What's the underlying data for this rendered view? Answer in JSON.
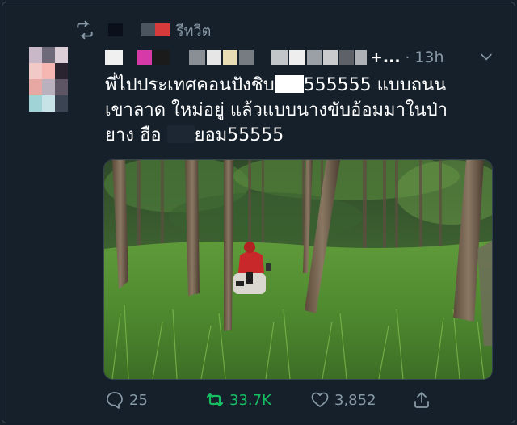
{
  "header": {
    "retweet_label": "รีทวีต"
  },
  "author": {
    "more_marker": "+...",
    "time": "13h"
  },
  "tweet": {
    "line1_a": "พี่ไปประเทศคอนปังชิบ",
    "line1_b": "555555 แบบถนน",
    "line2": "เขาลาด ใหม่อยู่ แล้วแบบนางขับอ้อมมาในป่า",
    "line3_a": "ยาง ฮือ ",
    "line3_b": "ยอม55555"
  },
  "photo": {
    "alt_icon": "rubber-plantation-scooter-photo"
  },
  "actions": {
    "replies": "25",
    "retweets": "33.7K",
    "likes": "3,852"
  },
  "colors": {
    "background": "#15202b",
    "muted": "#8899a6",
    "retweet_active": "#17bf63"
  }
}
